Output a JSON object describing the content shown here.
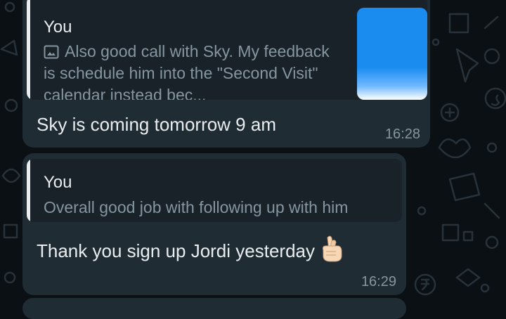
{
  "messages": [
    {
      "quote": {
        "author": "You",
        "media_icon": "image-icon",
        "text": "Also good call with Sky. My feedback is schedule him  into the \"Second Visit\" calendar instead bec..."
      },
      "body": "Sky is coming tomorrow 9 am",
      "time": "16:28"
    },
    {
      "quote": {
        "author": "You",
        "text": "Overall good job with following up with him"
      },
      "body": "Thank you sign up Jordi yesterday",
      "emoji": "crossed-fingers-emoji",
      "time": "16:29"
    }
  ],
  "colors": {
    "background": "#0b1014",
    "bubble": "#1f2c34",
    "quote_bg": "#182228",
    "text_primary": "#e9edef",
    "text_secondary": "#8696a0",
    "thumbnail_blue": "#1a8cf0"
  }
}
